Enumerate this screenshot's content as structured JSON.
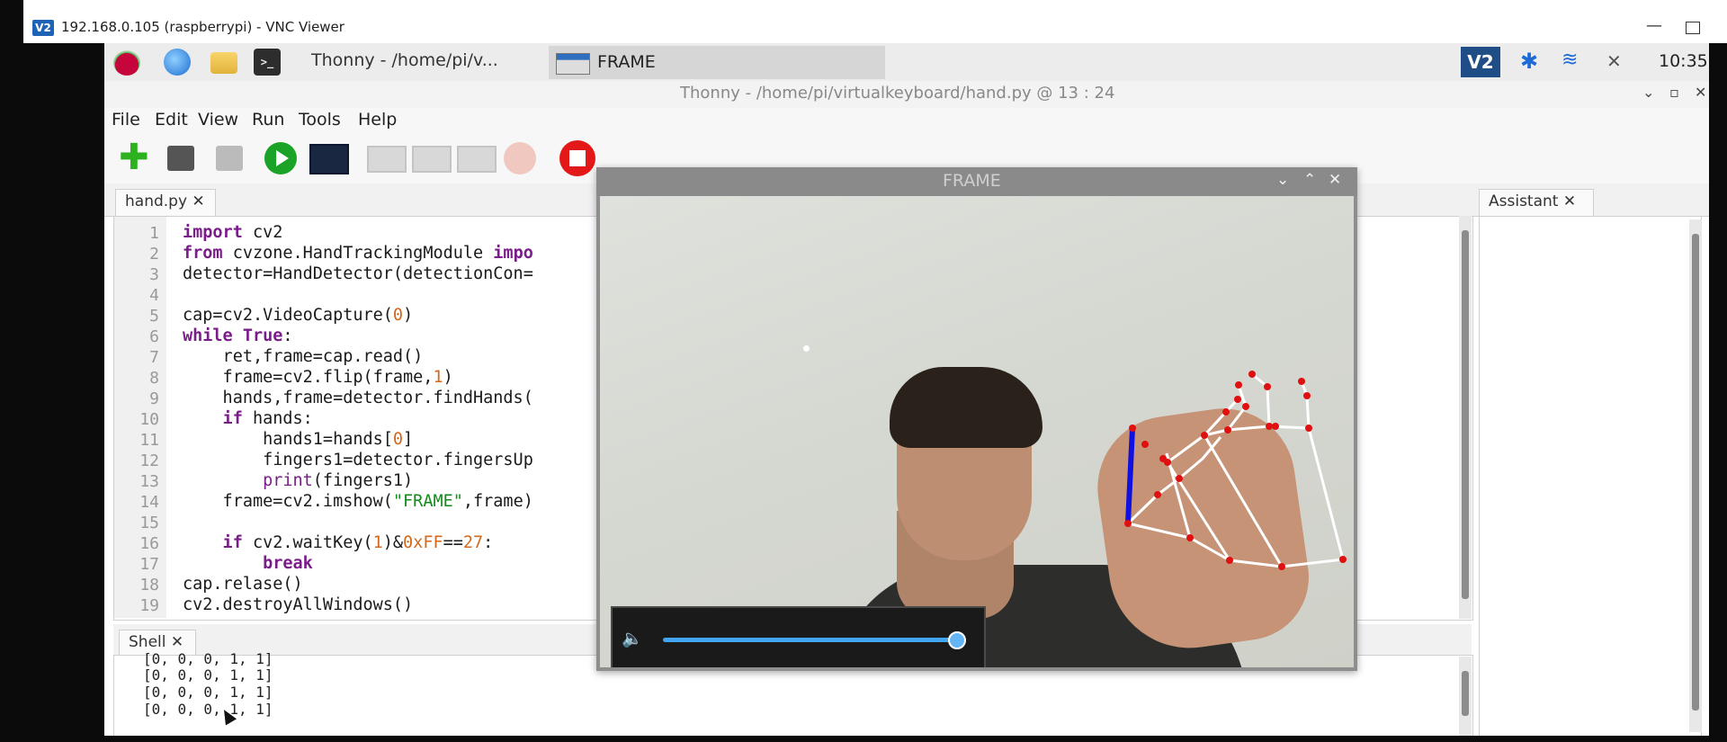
{
  "vnc": {
    "logo": "V2",
    "title": "192.168.0.105 (raspberrypi) - VNC Viewer",
    "minimize": "—"
  },
  "taskbar": {
    "thonny_task": "Thonny - /home/pi/v...",
    "frame_task": "FRAME",
    "vnc_tray": "V2",
    "bluetooth_glyph": "✱",
    "wifi_glyph": "≋",
    "volume_glyph": "✕",
    "clock": "10:35"
  },
  "thonny": {
    "title": "Thonny - /home/pi/virtualkeyboard/hand.py @ 13 : 24",
    "menu": [
      "File",
      "Edit",
      "View",
      "Run",
      "Tools",
      "Help"
    ],
    "editor_tab": "hand.py ✕",
    "assistant_tab": "Assistant ✕",
    "shell_tab": "Shell ✕",
    "line_numbers": [
      "1",
      "2",
      "3",
      "4",
      "5",
      "6",
      "7",
      "8",
      "9",
      "10",
      "11",
      "12",
      "13",
      "14",
      "15",
      "16",
      "17",
      "18",
      "19"
    ],
    "shell_output": [
      "[0, 0, 0, 1, 1]",
      "[0, 0, 0, 1, 1]",
      "[0, 0, 0, 1, 1]",
      "[0, 0, 0, 1, 1]"
    ]
  },
  "code": {
    "l1_kw": "import",
    "l1_rest": " cv2",
    "l2_kw1": "from",
    "l2_mid": " cvzone.HandTrackingModule ",
    "l2_kw2": "impo",
    "l3": "detector=HandDetector(detectionCon=",
    "l5_a": "cap=cv2.VideoCapture(",
    "l5_n": "0",
    "l5_b": ")",
    "l6_kw": "while",
    "l6_kw2": " True",
    "l6_b": ":",
    "l7": "    ret,frame=cap.read()",
    "l8_a": "    frame=cv2.flip(frame,",
    "l8_n": "1",
    "l8_b": ")",
    "l9": "    hands,frame=detector.findHands(",
    "l10_kw": "    if",
    "l10_b": " hands:",
    "l11_a": "        hands1=hands[",
    "l11_n": "0",
    "l11_b": "]",
    "l12": "        fingers1=detector.fingersUp",
    "l13_kw": "        print",
    "l13_b": "(fingers1)",
    "l14_a": "    frame=cv2.imshow(",
    "l14_s": "\"FRAME\"",
    "l14_b": ",frame)",
    "l16_kw": "    if",
    "l16_a": " cv2.waitKey(",
    "l16_n1": "1",
    "l16_b": ")&",
    "l16_n2": "0xFF",
    "l16_c": "==",
    "l16_n3": "27",
    "l16_d": ":",
    "l17_kw": "        break",
    "l18": "cap.relase()",
    "l19": "cv2.destroyAllWindows()"
  },
  "frame_window": {
    "title": "FRAME",
    "volume_glyph": "🔈",
    "playback_progress": 0.98
  },
  "colors": {
    "keyword": "#7a1c8a",
    "number": "#d2691e",
    "string": "#158a1a",
    "run_green": "#1aa327",
    "stop_red": "#e31818",
    "landmark_red": "#e01010",
    "landmark_blue": "#1010e0"
  },
  "icons": [
    "raspberry-menu-icon",
    "browser-icon",
    "file-manager-icon",
    "terminal-icon",
    "new-file-icon",
    "open-file-icon",
    "save-file-icon",
    "run-icon",
    "debug-icon",
    "step-over-icon",
    "step-into-icon",
    "step-out-icon",
    "resume-icon",
    "stop-icon",
    "bluetooth-icon",
    "wifi-icon",
    "volume-muted-icon"
  ]
}
